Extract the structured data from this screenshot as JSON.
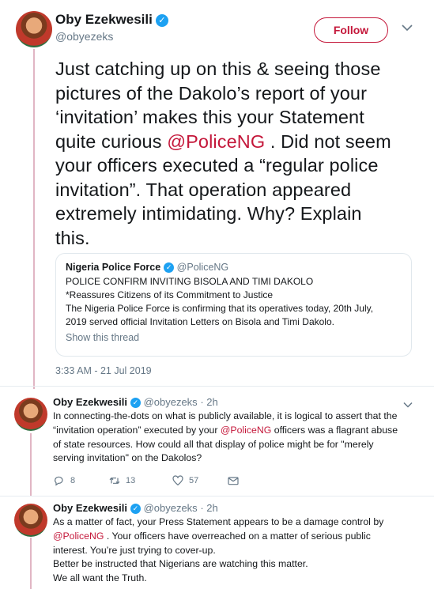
{
  "main_tweet": {
    "name": "Oby Ezekwesili",
    "handle": "@obyezeks",
    "follow_label": "Follow",
    "text_lines": [
      "Just catching up on this & seeing those",
      "pictures of the Dakolo’s report of your",
      "‘invitation’ makes this your Statement",
      "quite curious ",
      "your officers executed a “regular police",
      "invitation”. That operation appeared",
      "extremely intimidating. Why? Explain",
      "this."
    ],
    "mention": "@PoliceNG",
    "after_mention": " . Did not seem",
    "timestamp": "3:33 AM - 21 Jul 2019",
    "quote": {
      "name": "Nigeria Police Force",
      "handle": "@PoliceNG",
      "lines": [
        "POLICE CONFIRM INVITING BISOLA AND TIMI DAKOLO",
        "*Reassures Citizens of its Commitment to Justice",
        "The Nigeria Police Force is confirming that its operatives today, 20th July,",
        "2019 served official Invitation Letters on Bisola and Timi Dakolo."
      ],
      "show_thread": "Show this thread"
    }
  },
  "reply1": {
    "name": "Oby Ezekwesili",
    "handle": "@obyezeks",
    "time": "· 2h",
    "line1": "In connecting-the-dots on what is publicly available, it is logical to assert that the",
    "line2a": "“invitation operation” executed by your ",
    "mention": "@PoliceNG",
    "line2b": " officers was a flagrant abuse",
    "line3": "of state resources. How could all that display of police might be for \"merely",
    "line4": "serving invitation\" on the Dakolos?",
    "replies": "8",
    "retweets": "13",
    "likes": "57"
  },
  "reply2": {
    "name": "Oby Ezekwesili",
    "handle": "@obyezeks",
    "time": "· 2h",
    "line1": "As a matter of fact, your Press Statement appears to be a damage control by",
    "mention": "@PoliceNG",
    "line2b": " . Your officers have overreached on a matter of serious public",
    "line3": "interest. You’re just trying to cover-up.",
    "line4": "Better be instructed that Nigerians are watching this matter.",
    "line5": "We all want the Truth."
  },
  "colors": {
    "accent": "#c4173a",
    "muted": "#657786",
    "verified": "#1da1f2",
    "thread": "#e1b6c4"
  }
}
